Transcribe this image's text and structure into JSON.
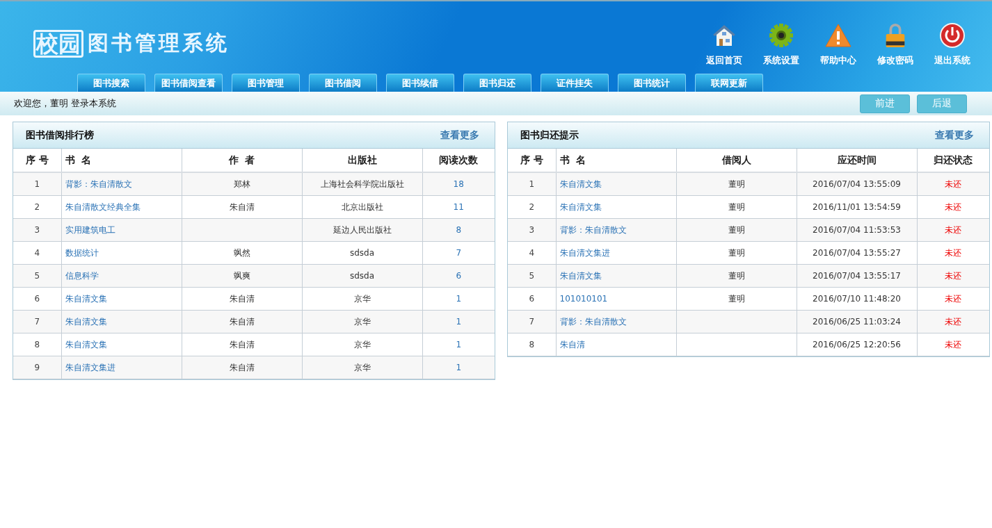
{
  "header": {
    "logo_badge": "校园",
    "logo_title": "图书管理系统",
    "shortcuts": [
      {
        "kind": "home",
        "label": "返回首页"
      },
      {
        "kind": "settings",
        "label": "系统设置"
      },
      {
        "kind": "help",
        "label": "帮助中心"
      },
      {
        "kind": "password",
        "label": "修改密码"
      },
      {
        "kind": "logout",
        "label": "退出系统"
      }
    ],
    "nav": [
      "图书搜索",
      "图书借阅查看",
      "图书管理",
      "图书借阅",
      "图书续借",
      "图书归还",
      "证件挂失",
      "图书统计",
      "联网更新"
    ]
  },
  "welcome_bar": {
    "text": "欢迎您，董明 登录本系统",
    "buttons": [
      "前进",
      "后退"
    ]
  },
  "ranking_panel": {
    "title": "图书借阅排行榜",
    "more_link": "查看更多",
    "columns": [
      "序 号",
      "书  名",
      "作  者",
      "出版社",
      "阅读次数"
    ],
    "rows": [
      {
        "no": "1",
        "title": "背影：朱自清散文",
        "author": "郑林",
        "publisher": "上海社会科学院出版社",
        "count": "18"
      },
      {
        "no": "2",
        "title": "朱自清散文经典全集",
        "author": "朱自清",
        "publisher": "北京出版社",
        "count": "11"
      },
      {
        "no": "3",
        "title": "实用建筑电工",
        "publisher": "延边人民出版社",
        "count": "8"
      },
      {
        "no": "4",
        "title": "数据统计",
        "author": "飒然",
        "publisher": "sdsda",
        "count": "7"
      },
      {
        "no": "5",
        "title": "信息科学",
        "author": "飒爽",
        "publisher": "sdsda",
        "count": "6"
      },
      {
        "no": "6",
        "title": "朱自清文集",
        "author": "朱自清",
        "publisher": "京华",
        "count": "1"
      },
      {
        "no": "7",
        "title": "朱自清文集",
        "author": "朱自清",
        "publisher": "京华",
        "count": "1"
      },
      {
        "no": "8",
        "title": "朱自清文集",
        "author": "朱自清",
        "publisher": "京华",
        "count": "1"
      },
      {
        "no": "9",
        "title": "朱自清文集进",
        "author": "朱自清",
        "publisher": "京华",
        "count": "1"
      }
    ]
  },
  "return_panel": {
    "title": "图书归还提示",
    "more_link": "查看更多",
    "columns": [
      "序 号",
      "书  名",
      "借阅人",
      "应还时间",
      "归还状态"
    ],
    "rows": [
      {
        "no": "1",
        "title": "朱自清文集",
        "borrower": "董明",
        "due": "2016/07/04 13:55:09",
        "status": "未还"
      },
      {
        "no": "2",
        "title": "朱自清文集",
        "borrower": "董明",
        "due": "2016/11/01 13:54:59",
        "status": "未还"
      },
      {
        "no": "3",
        "title": "背影：朱自清散文",
        "borrower": "董明",
        "due": "2016/07/04 11:53:53",
        "status": "未还"
      },
      {
        "no": "4",
        "title": "朱自清文集进",
        "borrower": "董明",
        "due": "2016/07/04 13:55:27",
        "status": "未还"
      },
      {
        "no": "5",
        "title": "朱自清文集",
        "borrower": "董明",
        "due": "2016/07/04 13:55:17",
        "status": "未还"
      },
      {
        "no": "6",
        "title": "101010101",
        "borrower": "董明",
        "due": "2016/07/10 11:48:20",
        "status": "未还"
      },
      {
        "no": "7",
        "title": "背影：朱自清散文",
        "due": "2016/06/25 11:03:24",
        "status": "未还"
      },
      {
        "no": "8",
        "title": "朱自清",
        "due": "2016/06/25 12:20:56",
        "status": "未还"
      }
    ]
  }
}
